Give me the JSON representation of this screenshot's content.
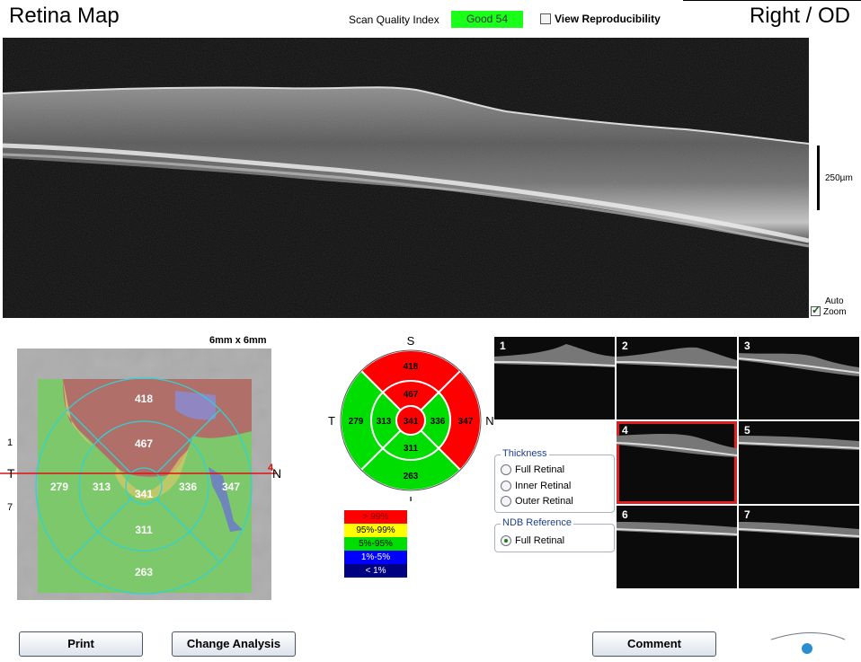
{
  "header": {
    "title": "Retina Map",
    "eye": "Right / OD",
    "sqi_label": "Scan Quality Index",
    "sqi_value": "Good  54",
    "view_reproducibility": "View Reproducibility"
  },
  "bscan": {
    "scale_label": "250µm",
    "auto_zoom_line1": "Auto",
    "auto_zoom_line2": "Zoom",
    "auto_zoom_checked": true
  },
  "fundus": {
    "size_label": "6mm x 6mm",
    "orient_t": "T",
    "orient_n": "N",
    "line_marker": "4",
    "side_ticks": [
      "1",
      "7"
    ],
    "values": {
      "superior_outer": "418",
      "superior_inner": "467",
      "temporal_outer": "279",
      "temporal_inner": "313",
      "center": "341",
      "nasal_inner": "336",
      "nasal_outer": "347",
      "inferior_inner": "311",
      "inferior_outer": "263"
    }
  },
  "chart_data": {
    "type": "etdrs_thickness_map",
    "orientation": {
      "top": "S",
      "bottom": "I",
      "left": "T",
      "right": "N"
    },
    "center": {
      "value": 341,
      "category": ">99%"
    },
    "inner_ring": {
      "superior": 467,
      "temporal": 313,
      "nasal": 336,
      "inferior": 311
    },
    "outer_ring": {
      "superior": 418,
      "temporal": 279,
      "nasal": 347,
      "inferior": 263
    },
    "inner_categories": {
      "superior": ">99%",
      "temporal": "5%-95%",
      "nasal": "5%-95%",
      "inferior": "5%-95%"
    },
    "outer_categories": {
      "superior": ">99%",
      "temporal": "5%-95%",
      "nasal": ">99%",
      "inferior": "5%-95%"
    },
    "legend": [
      {
        "label": "> 99%",
        "color": "#ff0000"
      },
      {
        "label": "95%-99%",
        "color": "#ffff00"
      },
      {
        "label": "5%-95%",
        "color": "#00dd00"
      },
      {
        "label": "1%-5%",
        "color": "#0000ff"
      },
      {
        "label": "< 1%",
        "color": "#000080"
      }
    ]
  },
  "thumbnails": {
    "labels": [
      "1",
      "2",
      "3",
      "4",
      "5",
      "6",
      "7"
    ],
    "selected": "4"
  },
  "thickness": {
    "title": "Thickness",
    "options": [
      "Full Retinal",
      "Inner Retinal",
      "Outer Retinal"
    ]
  },
  "ndb": {
    "title": "NDB Reference",
    "options": [
      "Full Retinal"
    ],
    "selected": "Full Retinal"
  },
  "buttons": {
    "print": "Print",
    "change_analysis": "Change Analysis",
    "comment": "Comment"
  },
  "logo": "optovue",
  "colors": {
    "good": "#1aff1a",
    "selected_outline": "#e02020",
    "scan_line": "#e01010",
    "ring_lines": "#2fd3d3"
  }
}
